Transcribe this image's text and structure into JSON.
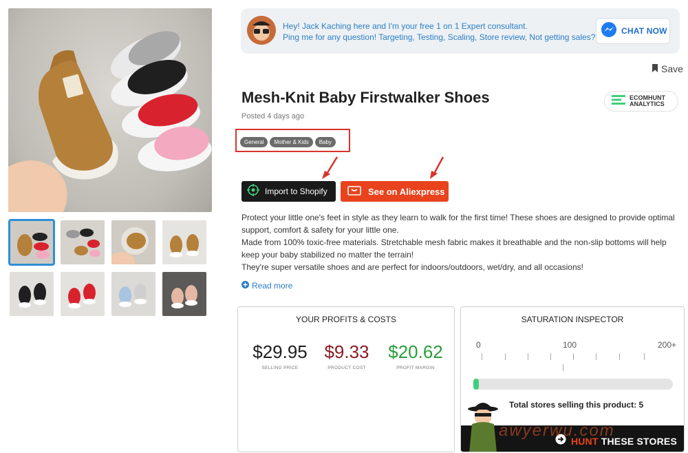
{
  "chat_banner": {
    "line1": "Hey! Jack Kaching here and I'm your free 1 on 1 Expert consultant.",
    "line2": "Ping me for any question! Targeting, Testing, Scaling, Store review, Not getting sales?",
    "button_label": "CHAT NOW",
    "button_icon": "messenger-icon"
  },
  "save_label": "Save",
  "product": {
    "title": "Mesh-Knit Baby Firstwalker Shoes",
    "posted": "Posted 4 days ago",
    "tags": [
      "General",
      "Mother & Kids",
      "Baby"
    ]
  },
  "ecomhunt_badge": {
    "line1": "ECOMHUNT",
    "line2": "ANALYTICS"
  },
  "buttons": {
    "shopify": "Import to Shopify",
    "aliexpress": "See on Aliexpress"
  },
  "description": {
    "p1": "Protect your little one's feet in style as they learn to walk for the first time! These shoes are designed to provide optimal support, comfort & safety for your little one.",
    "p2": "Made from 100% toxic-free materials. Stretchable mesh fabric makes it breathable and the non-slip bottoms will help keep your baby stabilized no matter the terrain!",
    "p3": "They're super versatile shoes and are perfect for indoors/outdoors, wet/dry, and all occasions!",
    "read_more": "Read more"
  },
  "profits": {
    "title": "YOUR PROFITS & COSTS",
    "selling_price": "$29.95",
    "selling_price_label": "SELLING PRICE",
    "product_cost": "$9.33",
    "product_cost_label": "PRODUCT COST",
    "profit_margin": "$20.62",
    "profit_margin_label": "PROFIT MARGIN"
  },
  "saturation": {
    "title": "SATURATION INSPECTOR",
    "scale": [
      "0",
      "100",
      "200+"
    ],
    "stores_selling": "Total stores selling this product: 5",
    "stores_selling_value": 5,
    "fill_fraction": 0.025,
    "hunt_label_accent": "HUNT",
    "hunt_label_rest": "THESE STORES"
  },
  "watermark": "awyerwu.com",
  "colors": {
    "accent_blue": "#2b7ec6",
    "aliexpress_red": "#e8431d",
    "price_dark": "#1e1e1e",
    "cost_red": "#8b1d24",
    "profit_green": "#2a9d3c",
    "hunt_green": "#3fcf7b",
    "highlight_red": "#d9332a"
  }
}
